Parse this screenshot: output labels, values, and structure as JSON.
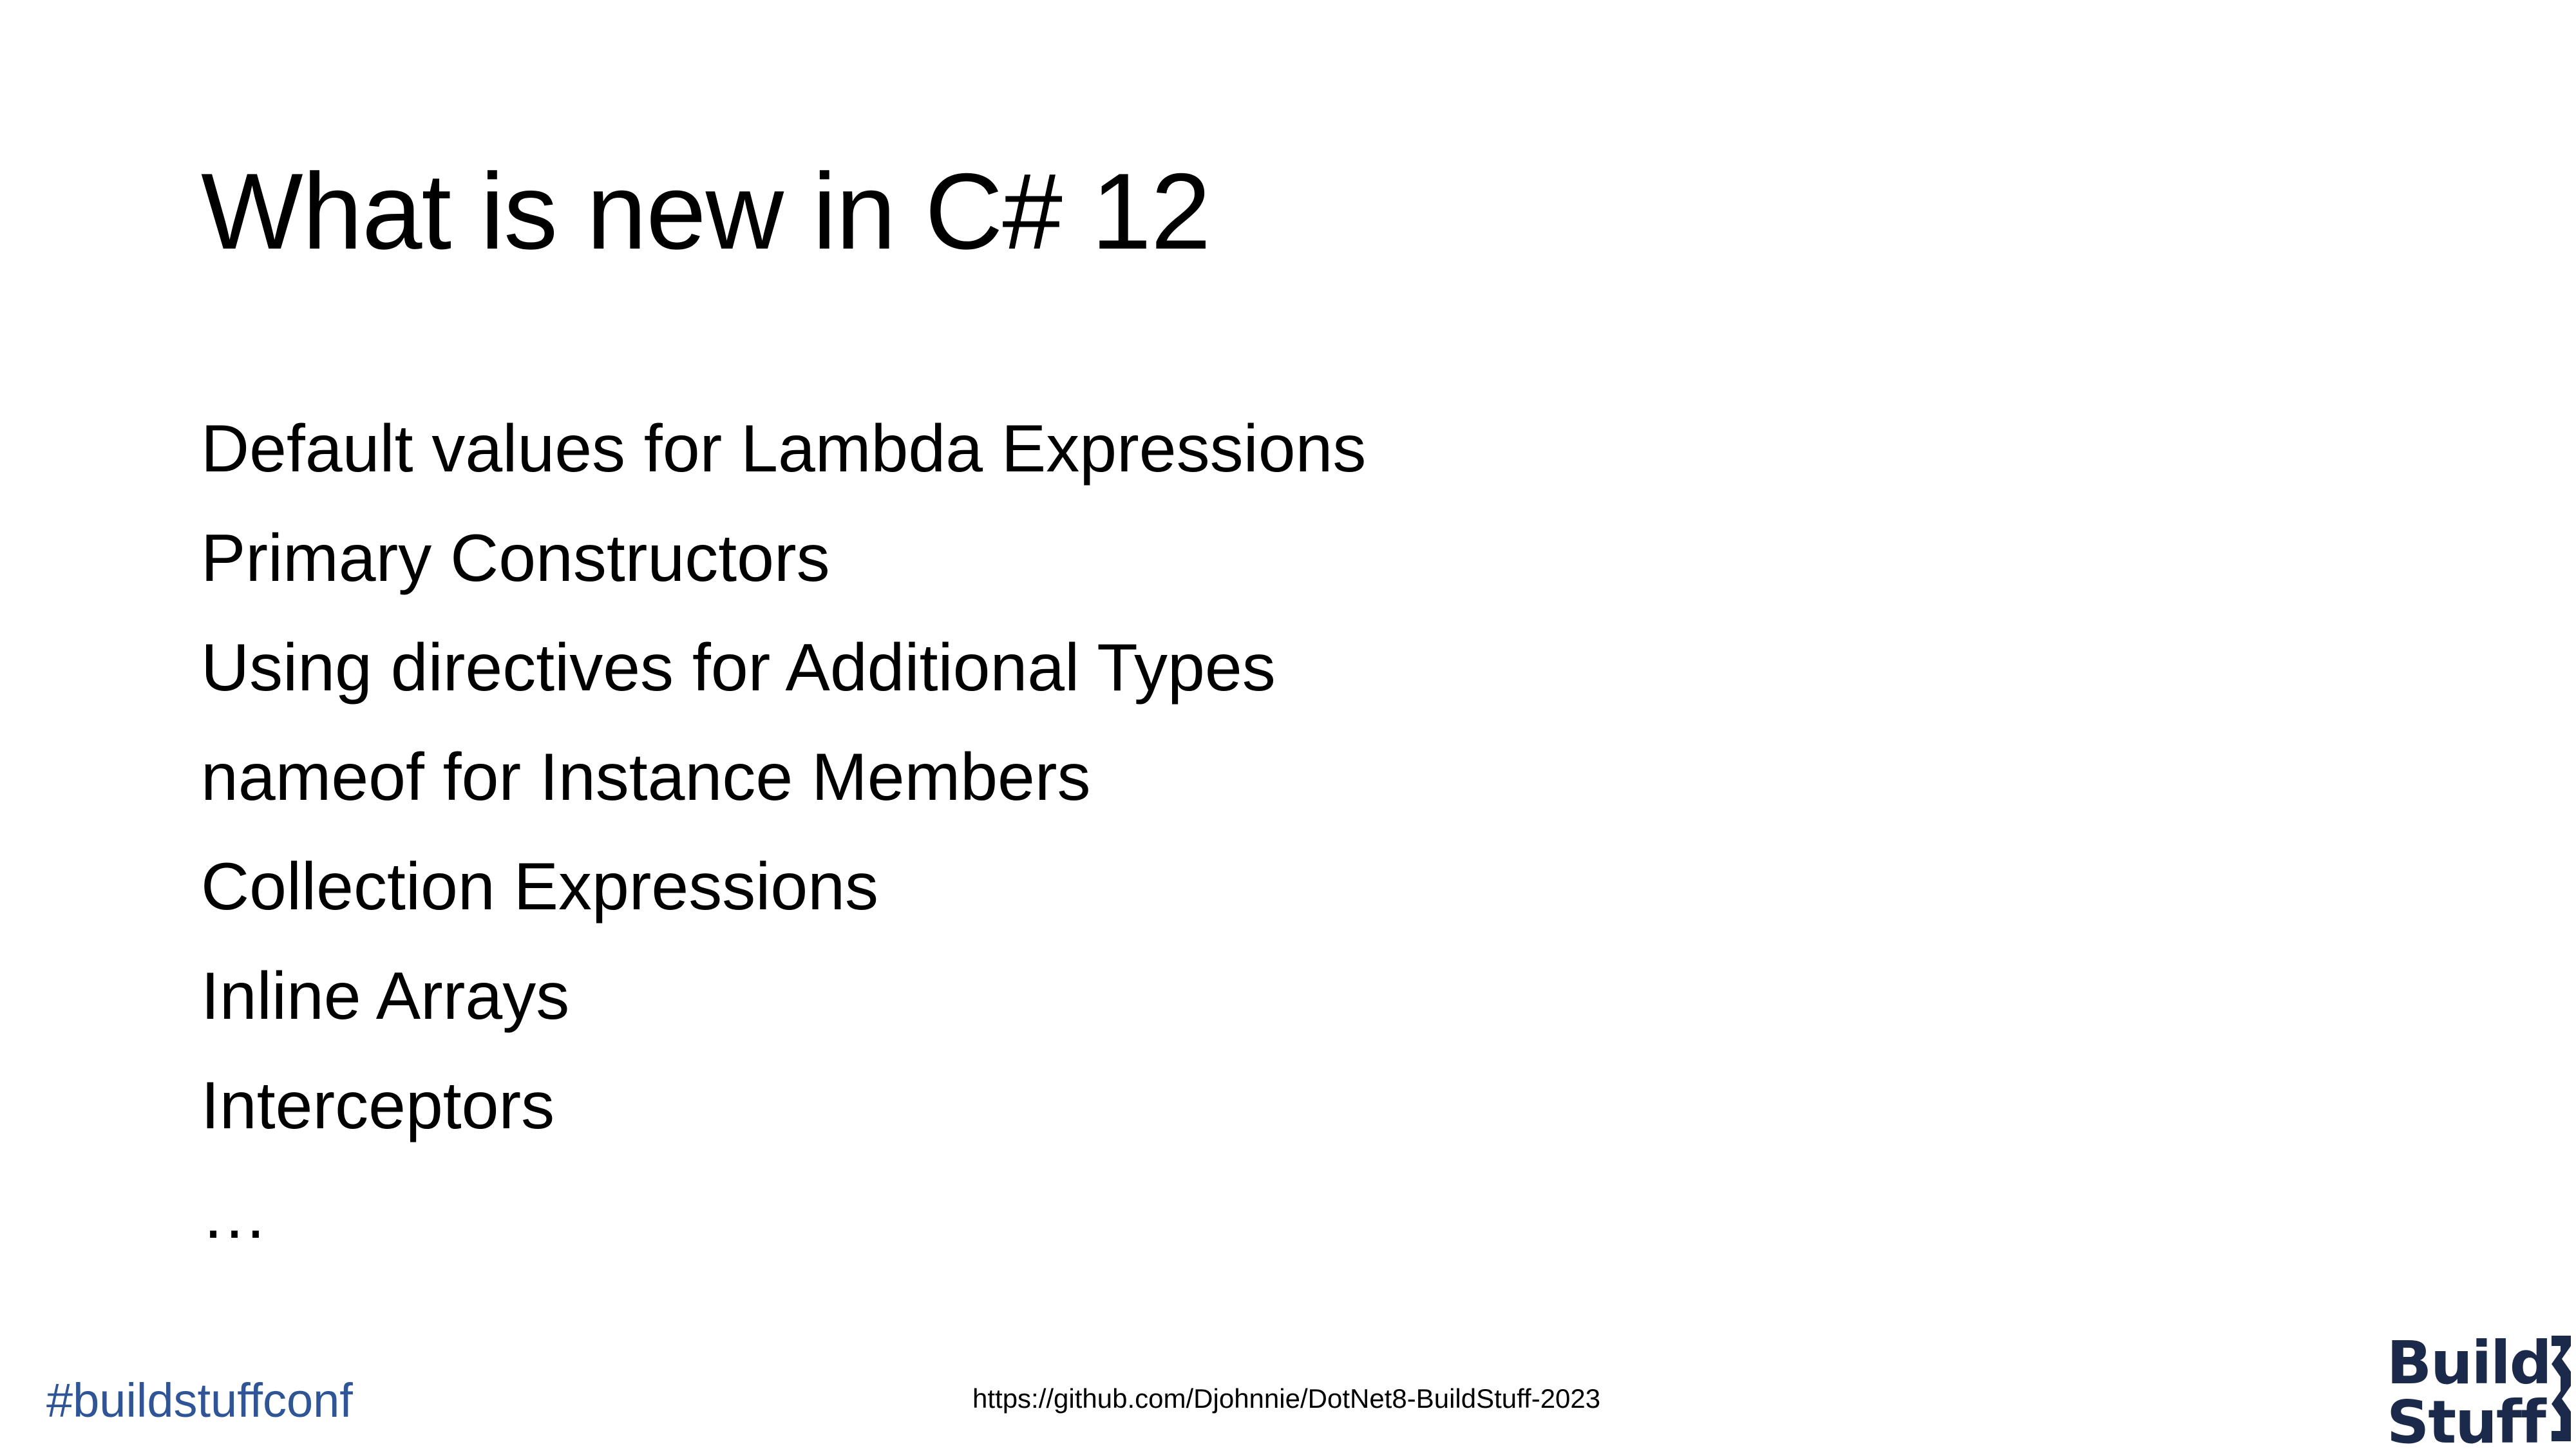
{
  "slide": {
    "title": "What is new in C# 12",
    "items": [
      "Default values for Lambda Expressions",
      "Primary Constructors",
      "Using directives for Additional Types",
      "nameof for Instance Members",
      "Collection Expressions",
      "Inline Arrays",
      "Interceptors",
      "…"
    ]
  },
  "footer": {
    "hashtag": "#buildstuffconf",
    "repo_url": "https://github.com/Djohnnie/DotNet8-BuildStuff-2023"
  },
  "logo": {
    "line1": "Build",
    "line2": "Stuff",
    "color": "#1b2a4a"
  },
  "colors": {
    "hashtag": "#2f5597",
    "text": "#000000",
    "background": "#ffffff"
  }
}
